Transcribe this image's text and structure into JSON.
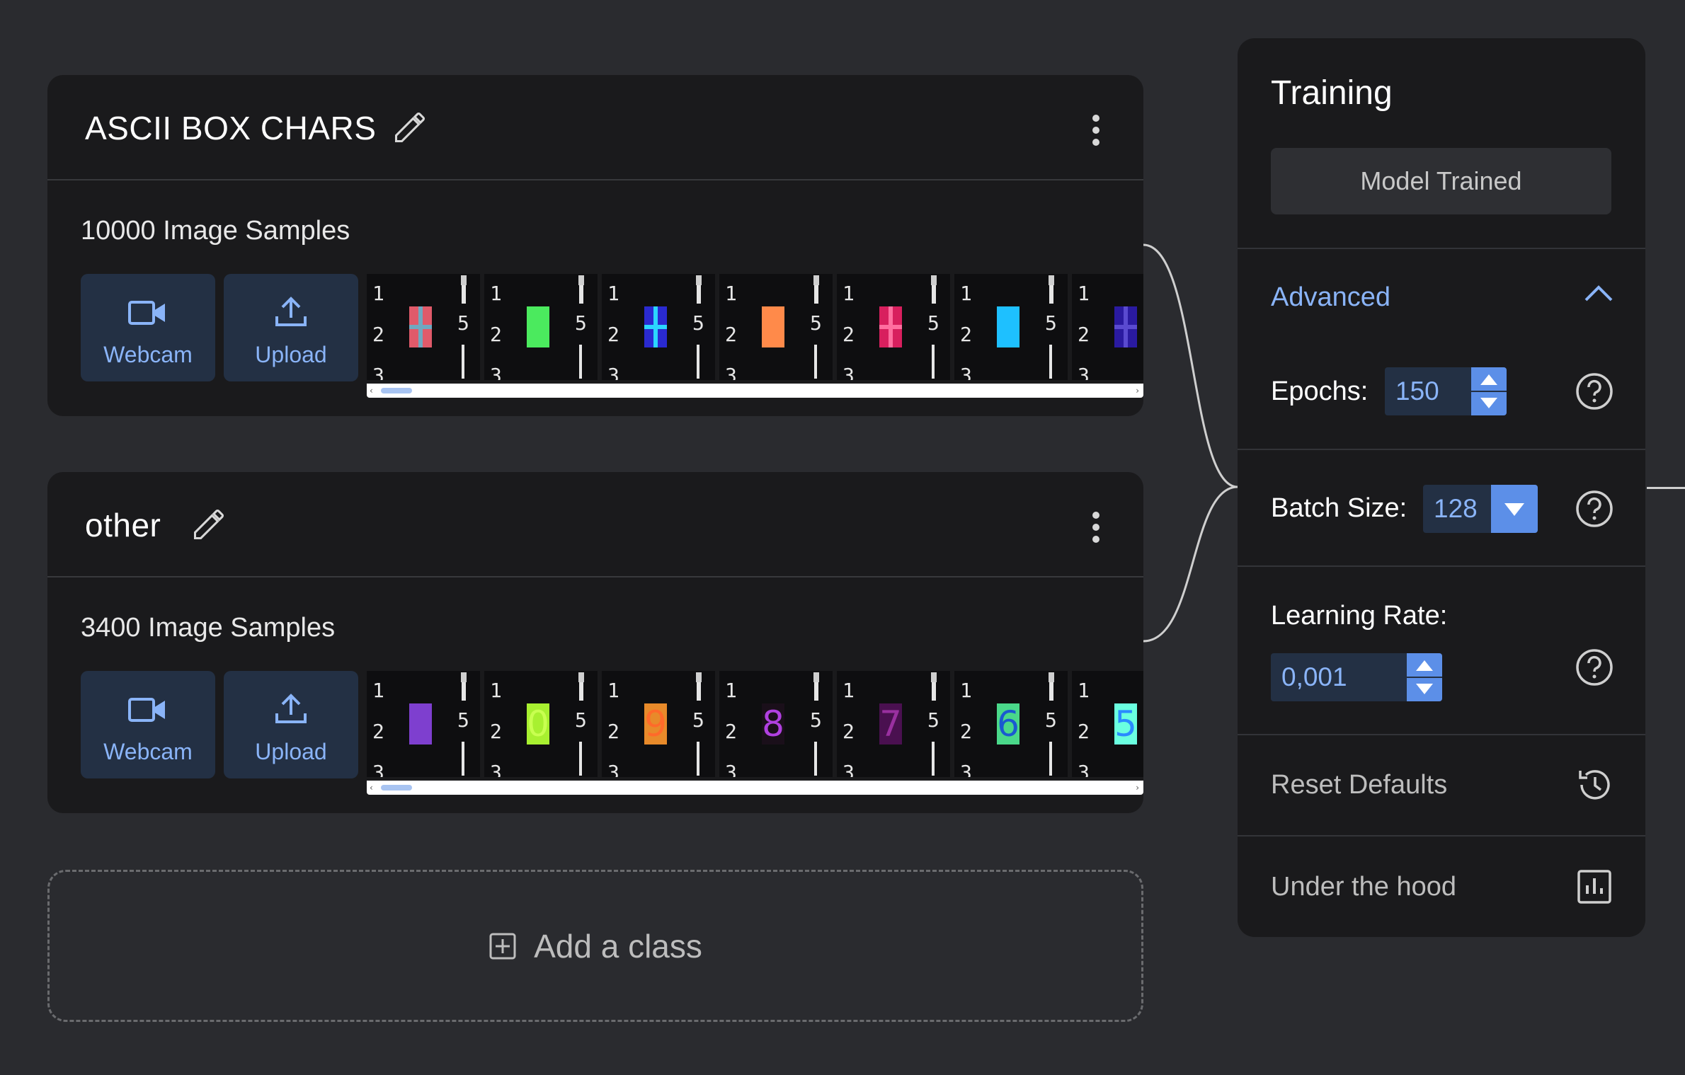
{
  "classes": [
    {
      "title": "ASCII BOX CHARS",
      "samples": "10000 Image Samples",
      "webcam_label": "Webcam",
      "upload_label": "Upload",
      "thumbs": [
        {
          "color": "#e05a6a",
          "cross": "#6fa8c0",
          "kind": "cross"
        },
        {
          "color": "#4bea5e",
          "kind": "block"
        },
        {
          "color": "#2a2ad0",
          "cross": "#2bd6ff",
          "kind": "cross"
        },
        {
          "color": "#ff8a4a",
          "kind": "block"
        },
        {
          "color": "#d81f5e",
          "cross": "#ff6fa0",
          "kind": "cross"
        },
        {
          "color": "#1ec0ff",
          "kind": "block"
        },
        {
          "color": "#2a1aa0",
          "cross": "#5a4ad0",
          "kind": "cross"
        }
      ]
    },
    {
      "title": "other",
      "samples": "3400 Image Samples",
      "webcam_label": "Webcam",
      "upload_label": "Upload",
      "thumbs": [
        {
          "color": "#7e3fcf",
          "kind": "block"
        },
        {
          "color": "#a8f030",
          "digit": "0",
          "digit_color": "#c8ff50",
          "kind": "digit"
        },
        {
          "color": "#e88a2a",
          "digit": "9",
          "digit_color": "#ff6a2a",
          "kind": "digit"
        },
        {
          "color": "#1a0f1a",
          "digit": "8",
          "digit_color": "#b040e0",
          "kind": "digit"
        },
        {
          "color": "#4a1050",
          "digit": "7",
          "digit_color": "#9a30a0",
          "kind": "digit"
        },
        {
          "color": "#4ad88a",
          "digit": "6",
          "digit_color": "#1a5ad0",
          "kind": "digit"
        },
        {
          "color": "#6affe0",
          "digit": "5",
          "digit_color": "#2a8aff",
          "kind": "digit"
        }
      ]
    }
  ],
  "thumb_ruler": {
    "n1": "1",
    "n2": "2",
    "n3": "3",
    "n5": "5"
  },
  "add_class_label": "Add a class",
  "training": {
    "title": "Training",
    "train_button": "Model Trained",
    "advanced_label": "Advanced",
    "epochs_label": "Epochs:",
    "epochs_value": "150",
    "batch_label": "Batch Size:",
    "batch_value": "128",
    "lr_label": "Learning Rate:",
    "lr_value": "0,001",
    "reset_label": "Reset Defaults",
    "hood_label": "Under the hood"
  },
  "colors": {
    "accent": "#8ab4f8",
    "accent_strong": "#5c8fe8",
    "card_bg": "#1a1a1c",
    "page_bg": "#2a2b2f"
  }
}
